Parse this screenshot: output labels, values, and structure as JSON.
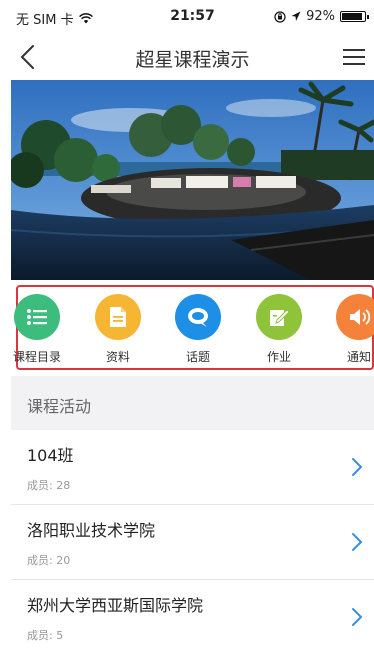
{
  "status_bar": {
    "carrier": "无 SIM 卡",
    "time": "21:57",
    "battery": "92%",
    "battery_level": 0.92,
    "icons": [
      "wifi-icon",
      "orientation-lock-icon",
      "location-arrow-icon",
      "battery-icon"
    ]
  },
  "nav": {
    "title": "超星课程演示",
    "back_icon": "back-chevron-icon",
    "menu_icon": "hamburger-menu-icon"
  },
  "quick_actions": [
    {
      "label": "课程目录",
      "icon": "list-icon",
      "color": "#3dbd7d"
    },
    {
      "label": "资料",
      "icon": "document-icon",
      "color": "#f6b533"
    },
    {
      "label": "话题",
      "icon": "chat-bubble-icon",
      "color": "#1e8fe6"
    },
    {
      "label": "作业",
      "icon": "edit-icon",
      "color": "#8fc33a"
    },
    {
      "label": "通知",
      "icon": "speaker-icon",
      "color": "#f5823b"
    }
  ],
  "section": {
    "title": "课程活动"
  },
  "activities": [
    {
      "name": "104班",
      "members": "成员: 28"
    },
    {
      "name": "洛阳职业技术学院",
      "members": "成员: 20"
    },
    {
      "name": "郑州大学西亚斯国际学院",
      "members": "成员: 5"
    }
  ],
  "colors": {
    "accent_border": "#d9363e",
    "chevron": "#3a8ee6"
  }
}
